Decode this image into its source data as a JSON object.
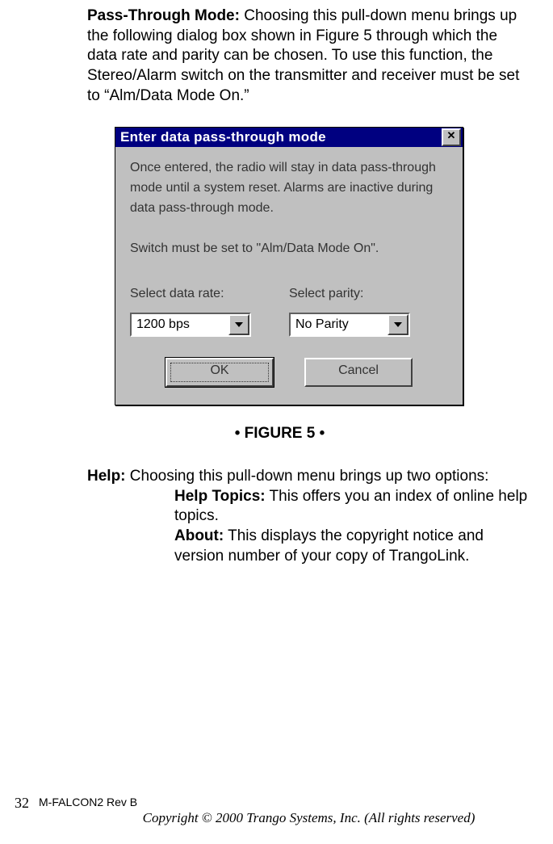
{
  "para1": {
    "heading": "Pass-Through Mode:",
    "text": " Choosing this pull-down menu brings up the following dialog box shown in Figure 5 through which the data rate and parity can be chosen. To use this function, the Stereo/Alarm switch on the transmitter and receiver must be set to “Alm/Data Mode On.”"
  },
  "dialog": {
    "title": "Enter data pass-through mode",
    "close_glyph": "✕",
    "body1": "Once entered, the radio will stay in data pass-through mode until a system reset.  Alarms are inactive during data pass-through mode.",
    "body2": "Switch must be set to \"Alm/Data Mode On\".",
    "select_rate_label": "Select data rate:",
    "select_parity_label": "Select parity:",
    "rate_value": "1200 bps",
    "parity_value": "No Parity",
    "ok_label": "OK",
    "cancel_label": "Cancel"
  },
  "figure_caption": "• FIGURE 5 •",
  "para2": {
    "heading": "Help:",
    "text": " Choosing this pull-down menu brings up two options:"
  },
  "sub1": {
    "heading": "Help Topics:",
    "text": " This offers you an index of online help topics."
  },
  "sub2": {
    "heading": "About:",
    "text": " This displays the copyright notice and version number of your copy of TrangoLink."
  },
  "footer": {
    "page": "32",
    "rev": "M-FALCON2 Rev B",
    "copyright": "Copyright © 2000 Trango Systems, Inc.  (All rights reserved)"
  }
}
